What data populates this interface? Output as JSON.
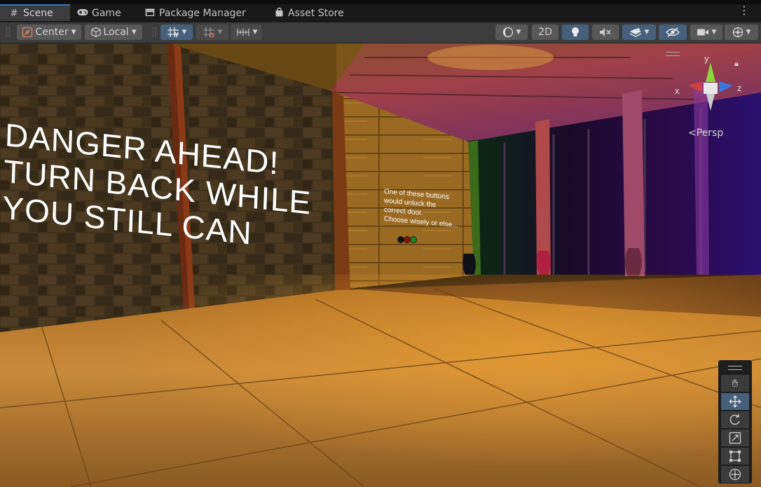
{
  "tabs": [
    {
      "label": "Scene",
      "icon": "grid-icon",
      "active": true
    },
    {
      "label": "Game",
      "icon": "gamepad-icon",
      "active": false
    },
    {
      "label": "Package Manager",
      "icon": "package-icon",
      "active": false
    },
    {
      "label": "Asset Store",
      "icon": "shopping-bag-icon",
      "active": false
    }
  ],
  "toolbar": {
    "pivot_mode": "Center",
    "pivot_rotation": "Local",
    "toggle_2d": "2D"
  },
  "scene": {
    "sign_lines": [
      "DANGER AHEAD!",
      "TURN BACK WHILE",
      "YOU STILL CAN"
    ],
    "hint_lines": [
      "One of these buttons",
      "would unlock the",
      "correct door.",
      "Choose wisely or else..."
    ],
    "button_colors": [
      "#101010",
      "#8a1010",
      "#138a22"
    ]
  },
  "gizmo": {
    "projection": "Persp",
    "axis_y": "y",
    "axis_x": "x",
    "axis_z": "z"
  },
  "tools": [
    "hand-tool",
    "move-tool",
    "rotate-tool",
    "scale-tool",
    "rect-tool",
    "transform-tool"
  ],
  "colors": {
    "accent": "#3a79bb",
    "active_button": "#46607c"
  }
}
